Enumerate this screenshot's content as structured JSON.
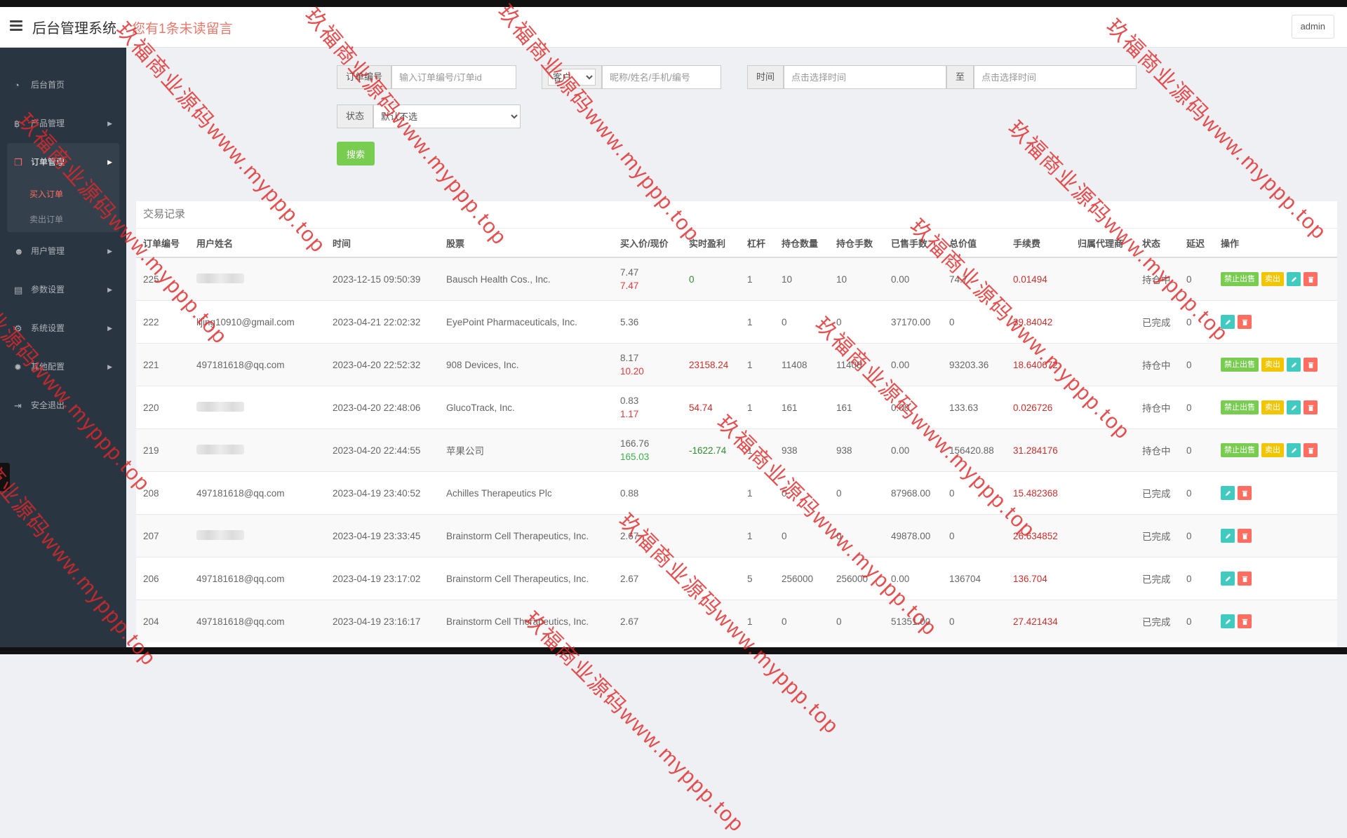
{
  "header": {
    "title": "后台管理系统",
    "notice": "您有1条未读留言",
    "admin_label": "admin"
  },
  "sidebar": {
    "items": [
      {
        "label": "后台首页",
        "icon": "dashboard-icon"
      },
      {
        "label": "产品管理",
        "icon": "bitcoin-icon"
      },
      {
        "label": "订单管理",
        "icon": "copy-icon"
      },
      {
        "label": "用户管理",
        "icon": "user-icon"
      },
      {
        "label": "参数设置",
        "icon": "file-icon"
      },
      {
        "label": "系统设置",
        "icon": "cogs-icon"
      },
      {
        "label": "其他配置",
        "icon": "gear-icon"
      },
      {
        "label": "安全退出",
        "icon": "sign-out-icon"
      }
    ],
    "order_sub": [
      {
        "label": "买入订单",
        "active": true
      },
      {
        "label": "卖出订单",
        "active": false
      }
    ]
  },
  "search": {
    "order_label": "订单编号",
    "order_placeholder": "输入订单编号/订单id",
    "customer_select": "客户",
    "customer_placeholder": "昵称/姓名/手机/编号",
    "time_label": "时间",
    "time_start_placeholder": "点击选择时间",
    "time_to": "至",
    "time_end_placeholder": "点击选择时间",
    "status_label": "状态",
    "status_select": "默认不选",
    "search_button": "搜索"
  },
  "panel": {
    "title": "交易记录",
    "columns": [
      "订单编号",
      "用户姓名",
      "时间",
      "股票",
      "买入价/现价",
      "实时盈利",
      "杠杆",
      "持仓数量",
      "持仓手数",
      "已售手数",
      "总价值",
      "手续费",
      "归属代理商",
      "状态",
      "延迟",
      "操作"
    ],
    "rows": [
      {
        "id": "225",
        "user": "",
        "time": "2023-12-15 09:50:39",
        "stock": "Bausch Health Cos., Inc.",
        "buy": "7.47",
        "cur": "7.47",
        "cur_color": "red",
        "pl": "0",
        "pl_color": "green",
        "lev": "1",
        "qty": "10",
        "lots": "10",
        "sold": "0.00",
        "total": "74.7",
        "fee": "0.01494",
        "agent": "",
        "status": "持仓中",
        "delay": "0",
        "holding": true
      },
      {
        "id": "222",
        "user": "lijing10910@gmail.com",
        "time": "2023-04-21 22:02:32",
        "stock": "EyePoint Pharmaceuticals, Inc.",
        "buy": "5.36",
        "cur": "",
        "cur_color": "",
        "pl": "",
        "pl_color": "",
        "lev": "1",
        "qty": "0",
        "lots": "0",
        "sold": "37170.00",
        "total": "0",
        "fee": "39.84042",
        "agent": "",
        "status": "已完成",
        "delay": "0",
        "holding": false
      },
      {
        "id": "221",
        "user": "497181618@qq.com",
        "time": "2023-04-20 22:52:32",
        "stock": "908 Devices, Inc.",
        "buy": "8.17",
        "cur": "10.20",
        "cur_color": "red",
        "pl": "23158.24",
        "pl_color": "red",
        "lev": "1",
        "qty": "11408",
        "lots": "11408",
        "sold": "0.00",
        "total": "93203.36",
        "fee": "18.640672",
        "agent": "",
        "status": "持仓中",
        "delay": "0",
        "holding": true
      },
      {
        "id": "220",
        "user": "",
        "time": "2023-04-20 22:48:06",
        "stock": "GlucoTrack, Inc.",
        "buy": "0.83",
        "cur": "1.17",
        "cur_color": "red",
        "pl": "54.74",
        "pl_color": "red",
        "lev": "1",
        "qty": "161",
        "lots": "161",
        "sold": "0.00",
        "total": "133.63",
        "fee": "0.026726",
        "agent": "",
        "status": "持仓中",
        "delay": "0",
        "holding": true
      },
      {
        "id": "219",
        "user": "",
        "time": "2023-04-20 22:44:55",
        "stock": "苹果公司",
        "buy": "166.76",
        "cur": "165.03",
        "cur_color": "green",
        "pl": "-1622.74",
        "pl_color": "green",
        "lev": "1",
        "qty": "938",
        "lots": "938",
        "sold": "0.00",
        "total": "156420.88",
        "fee": "31.284176",
        "agent": "",
        "status": "持仓中",
        "delay": "0",
        "holding": true
      },
      {
        "id": "208",
        "user": "497181618@qq.com",
        "time": "2023-04-19 23:40:52",
        "stock": "Achilles Therapeutics Plc",
        "buy": "0.88",
        "cur": "",
        "cur_color": "",
        "pl": "",
        "pl_color": "",
        "lev": "1",
        "qty": "0",
        "lots": "0",
        "sold": "87968.00",
        "total": "0",
        "fee": "15.482368",
        "agent": "",
        "status": "已完成",
        "delay": "0",
        "holding": false
      },
      {
        "id": "207",
        "user": "",
        "time": "2023-04-19 23:33:45",
        "stock": "Brainstorm Cell Therapeutics, Inc.",
        "buy": "2.67",
        "cur": "",
        "cur_color": "",
        "pl": "",
        "pl_color": "",
        "lev": "1",
        "qty": "0",
        "lots": "0",
        "sold": "49878.00",
        "total": "0",
        "fee": "26.634852",
        "agent": "",
        "status": "已完成",
        "delay": "0",
        "holding": false
      },
      {
        "id": "206",
        "user": "497181618@qq.com",
        "time": "2023-04-19 23:17:02",
        "stock": "Brainstorm Cell Therapeutics, Inc.",
        "buy": "2.67",
        "cur": "",
        "cur_color": "",
        "pl": "",
        "pl_color": "",
        "lev": "5",
        "qty": "256000",
        "lots": "256000",
        "sold": "0.00",
        "total": "136704",
        "fee": "136.704",
        "agent": "",
        "status": "已完成",
        "delay": "0",
        "holding": false
      },
      {
        "id": "204",
        "user": "497181618@qq.com",
        "time": "2023-04-19 23:16:17",
        "stock": "Brainstorm Cell Therapeutics, Inc.",
        "buy": "2.67",
        "cur": "",
        "cur_color": "",
        "pl": "",
        "pl_color": "",
        "lev": "1",
        "qty": "0",
        "lots": "0",
        "sold": "51351.00",
        "total": "0",
        "fee": "27.421434",
        "agent": "",
        "status": "已完成",
        "delay": "0",
        "holding": false
      }
    ],
    "btn_stop_sell": "禁止出售",
    "btn_sell": "卖出"
  },
  "watermark": "玖福商业源码www.myppp.top",
  "colors": {
    "sidebar_bg": "#2a3542",
    "accent_red": "#ff6c60",
    "search_green": "#78cd51",
    "sell_yellow": "#f1c500",
    "edit_teal": "#41cac0"
  }
}
